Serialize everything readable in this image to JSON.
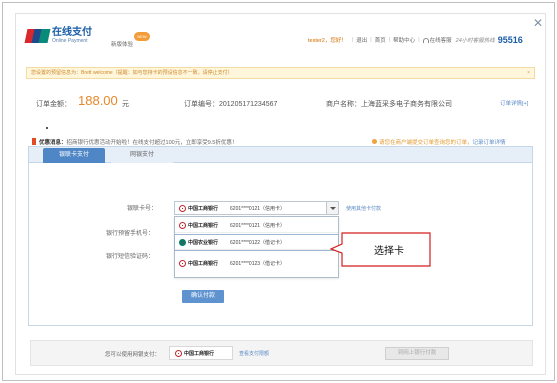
{
  "header": {
    "logo_text": "UnionPay 银联",
    "title_zh": "在线支付",
    "title_en": "Online Payment",
    "new_version_label": "新版体验",
    "new_badge": "NEW",
    "user": "tester2，您好！",
    "nav": [
      "退出",
      "首页",
      "帮助中心",
      "在线客服"
    ],
    "hotline_label": "24小时客服热线",
    "hotline_number": "95516"
  },
  "notice": {
    "text": "您设置的预留信息为：Brett welcome（提醒：如与您持卡的预设信息不一致，请停止支付）",
    "close": "×"
  },
  "order": {
    "amount_label": "订单金额：",
    "amount": "188.00",
    "unit": "元",
    "number": "订单编号：201205171234567",
    "merchant": "商户名称：上海蓝采多电子商务有限公司",
    "detail_link": "订单详情[+]"
  },
  "promo": {
    "label": "优惠消息：",
    "text": "招商银行优惠活动开始啦！在线支付超过100元，立即享受9.5折优惠！",
    "tip": "请您在商户端提交订单查询您的订单，",
    "tip_link": "记录订单详情"
  },
  "tabs": [
    {
      "label": "银联卡支付"
    },
    {
      "label": "网银支付"
    }
  ],
  "form": {
    "card_label": "银联卡号：",
    "phone_label": "银行预留手机号：",
    "sms_label": "银行短信验证码：",
    "other_card_link": "使用其他卡付款",
    "selected": {
      "bank": "中国工商银行",
      "number": "6201****0121（信用卡）"
    },
    "options": [
      {
        "bank": "中国工商银行",
        "number": "6201****0121（信用卡）",
        "type": "icbc"
      },
      {
        "bank": "中国农业银行",
        "number": "6201****0122（借记卡）",
        "type": "agri"
      },
      {
        "bank": "中国工商银行",
        "number": "6201****0123（借记卡）",
        "type": "icbc"
      }
    ],
    "confirm_label": "确认付款"
  },
  "callout": {
    "text": "选择卡"
  },
  "bottom": {
    "text": "您可以使用网银支付：",
    "bank": "中国工商银行",
    "view_link": "查看支付限额",
    "goto_label": "到网上银行付款"
  }
}
